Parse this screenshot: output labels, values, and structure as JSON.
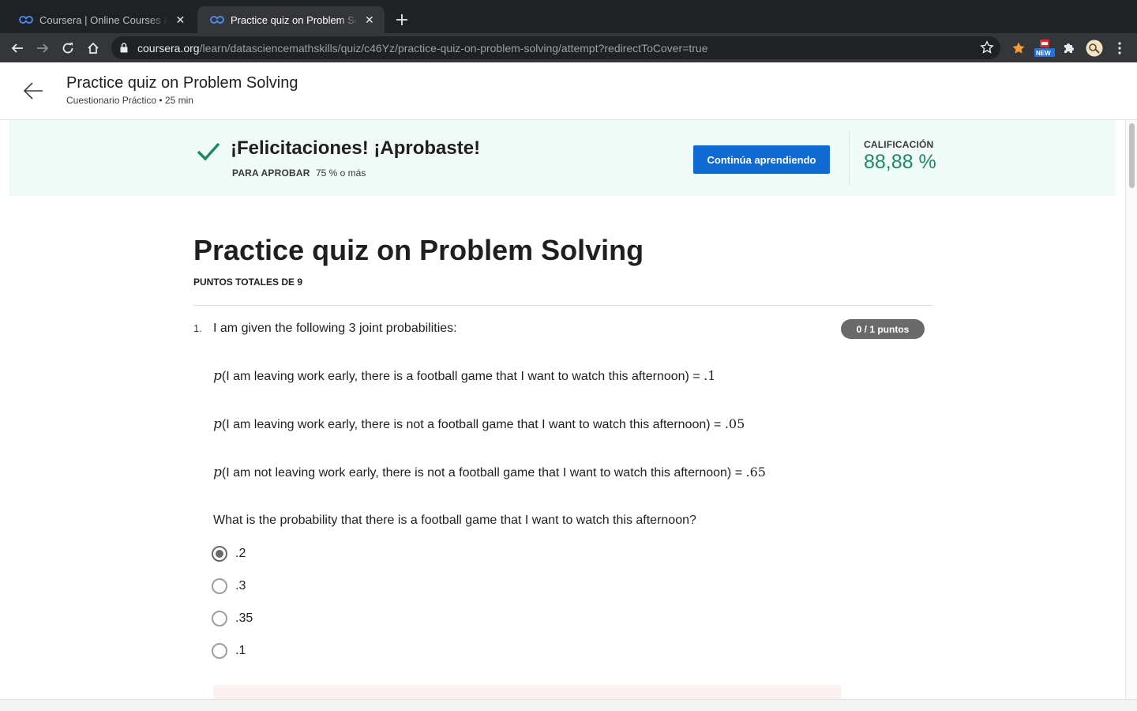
{
  "browser": {
    "tabs": [
      {
        "title": "Coursera | Online Courses & Credentials From Top Educators",
        "active": false
      },
      {
        "title": "Practice quiz on Problem Solving",
        "active": true
      }
    ],
    "url_host": "coursera.org",
    "url_path": "/learn/datasciencemathskills/quiz/c46Yz/practice-quiz-on-problem-solving/attempt?redirectToCover=true",
    "new_badge": "NEW"
  },
  "header": {
    "title": "Practice quiz on Problem Solving",
    "subtitle": "Cuestionario Práctico • 25 min"
  },
  "banner": {
    "congrats": "¡Felicitaciones! ¡Aprobaste!",
    "pass_label": "PARA APROBAR",
    "pass_value": "75 % o más",
    "continue_label": "Continúa aprendiendo",
    "grade_label": "CALIFICACIÓN",
    "grade_value": "88,88 %",
    "accent_color": "#1e8a62",
    "button_color": "#0f6ad2"
  },
  "quiz": {
    "title": "Practice quiz on Problem Solving",
    "total_points": "PUNTOS TOTALES DE 9",
    "question": {
      "number": "1.",
      "text": "I am given the following 3 joint probabilities:",
      "points": "0 / 1 puntos",
      "probabilities": [
        {
          "p": "p",
          "text": "(I am leaving work early, there is a football game that I want to watch this afternoon) = ",
          "value": ".1"
        },
        {
          "p": "p",
          "text": "(I am leaving work early, there is not a football game that I want to watch this afternoon) = ",
          "value": ".05"
        },
        {
          "p": "p",
          "text": "(I am not leaving work early, there is not a football game that I want to watch this afternoon) = ",
          "value": ".65"
        }
      ],
      "prompt": "What is the probability that there is a football game that I want to watch this afternoon?",
      "options": [
        {
          "label": ".2",
          "selected": true
        },
        {
          "label": ".3",
          "selected": false
        },
        {
          "label": ".35",
          "selected": false
        },
        {
          "label": ".1",
          "selected": false
        }
      ]
    }
  }
}
